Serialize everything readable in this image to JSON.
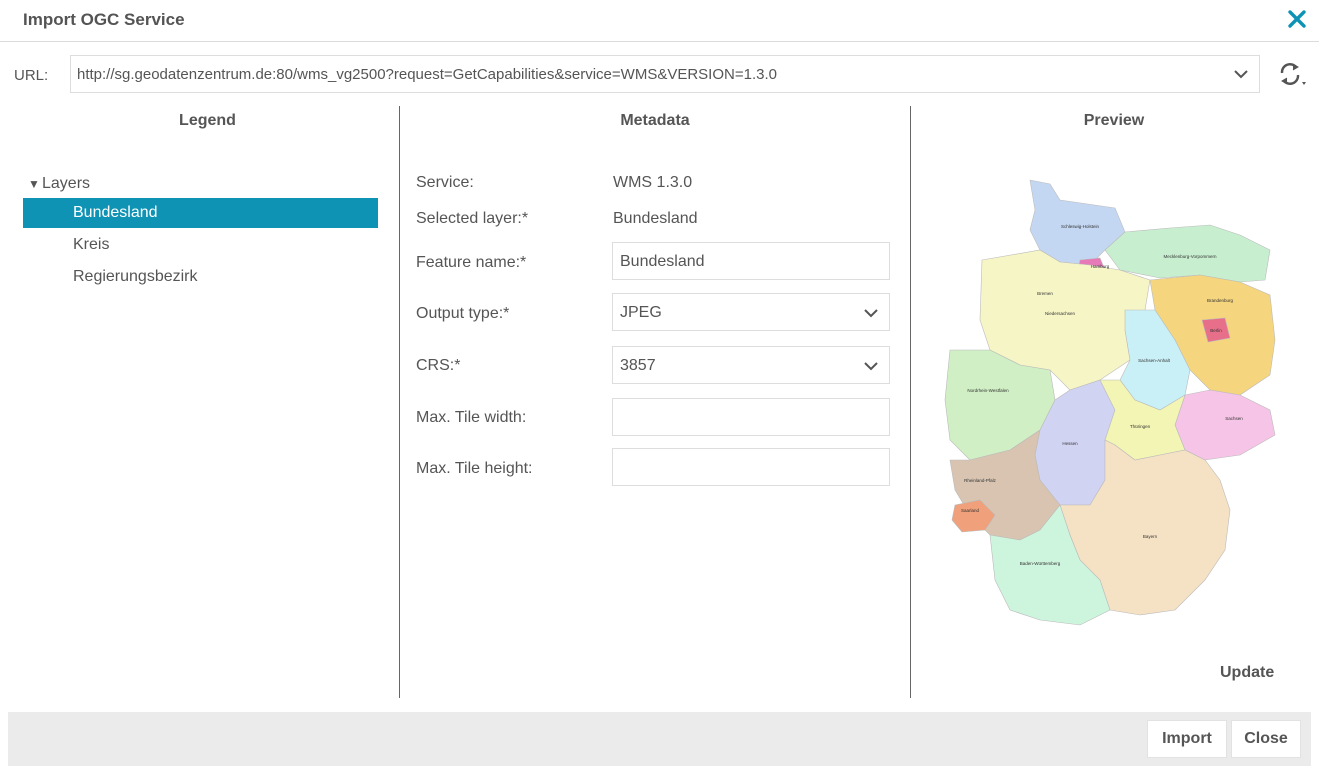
{
  "dialog": {
    "title": "Import OGC Service",
    "close_icon": "close-x-icon",
    "accent_color": "#0f93b4"
  },
  "url": {
    "label": "URL:",
    "value": "http://sg.geodatenzentrum.de:80/wms_vg2500?request=GetCapabilities&service=WMS&VERSION=1.3.0"
  },
  "panels": {
    "legend": "Legend",
    "metadata": "Metadata",
    "preview": "Preview"
  },
  "legend": {
    "root": "Layers",
    "items": [
      {
        "label": "Bundesland",
        "selected": true
      },
      {
        "label": "Kreis",
        "selected": false
      },
      {
        "label": "Regierungsbezirk",
        "selected": false
      }
    ]
  },
  "metadata": {
    "service_label": "Service:",
    "service_value": "WMS 1.3.0",
    "selected_layer_label": "Selected layer:*",
    "selected_layer_value": "Bundesland",
    "feature_name_label": "Feature name:*",
    "feature_name_value": "Bundesland",
    "output_type_label": "Output type:*",
    "output_type_value": "JPEG",
    "crs_label": "CRS:*",
    "crs_value": "3857",
    "max_tile_width_label": "Max. Tile width:",
    "max_tile_width_value": "",
    "max_tile_height_label": "Max. Tile height:",
    "max_tile_height_value": ""
  },
  "preview": {
    "update_label": "Update",
    "states": [
      {
        "name": "Schleswig-Holstein",
        "color": "#c4d7f2"
      },
      {
        "name": "Mecklenburg-Vorpommern",
        "color": "#c7efcf"
      },
      {
        "name": "Hamburg",
        "color": "#e67ab8"
      },
      {
        "name": "Bremen",
        "color": "#f0a0a8"
      },
      {
        "name": "Niedersachsen",
        "color": "#f6f5c6"
      },
      {
        "name": "Brandenburg",
        "color": "#f5d57d"
      },
      {
        "name": "Berlin",
        "color": "#e86f8a"
      },
      {
        "name": "Sachsen-Anhalt",
        "color": "#c9f0f7"
      },
      {
        "name": "Nordrhein-Westfalen",
        "color": "#d0efc4"
      },
      {
        "name": "Sachsen",
        "color": "#f6c4e6"
      },
      {
        "name": "Hessen",
        "color": "#d1d3f3"
      },
      {
        "name": "Thüringen",
        "color": "#f3f5b4"
      },
      {
        "name": "Rheinland-Pfalz",
        "color": "#d8c4b0"
      },
      {
        "name": "Saarland",
        "color": "#f0a07a"
      },
      {
        "name": "Bayern",
        "color": "#f5e1c4"
      },
      {
        "name": "Baden-Württemberg",
        "color": "#cdf4dc"
      }
    ]
  },
  "footer": {
    "import_label": "Import",
    "close_label": "Close"
  }
}
